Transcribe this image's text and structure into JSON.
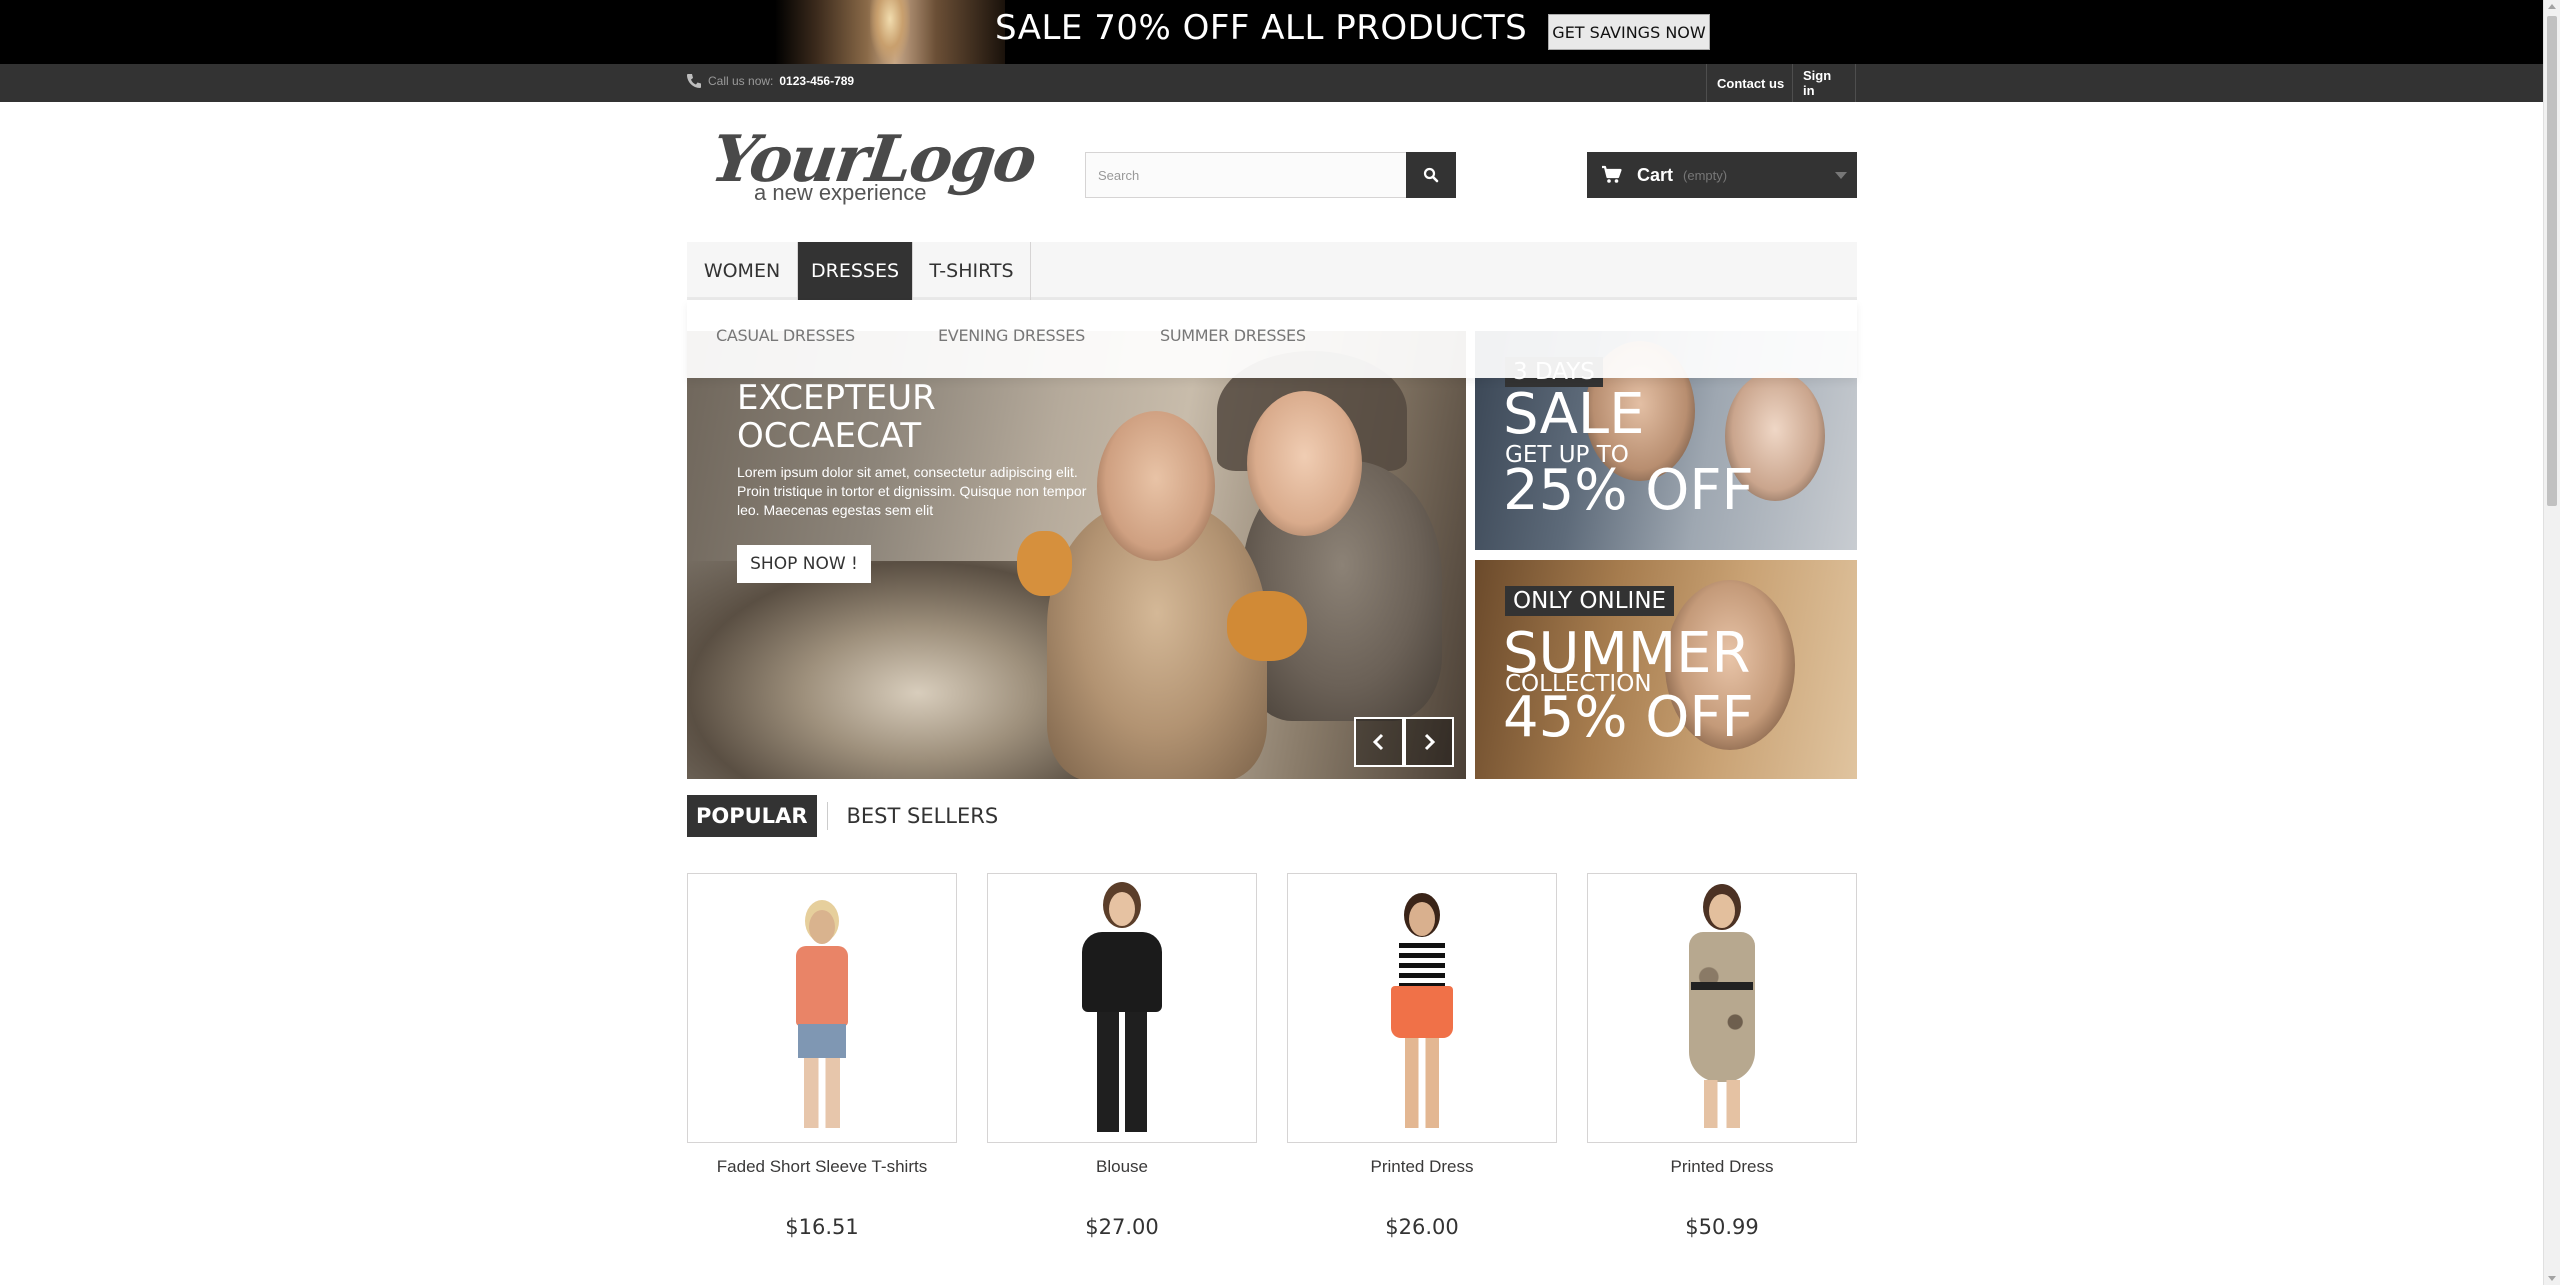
{
  "promo": {
    "text": "SALE 70% OFF ALL PRODUCTS",
    "button": "GET SAVINGS NOW"
  },
  "topbar": {
    "call_label": "Call us now:",
    "phone": "0123-456-789",
    "contact": "Contact us",
    "signin": "Sign in"
  },
  "header": {
    "logo_script": "YourLogo",
    "logo_tagline": "a new experience",
    "search_placeholder": "Search",
    "cart_label": "Cart",
    "cart_status": "(empty)"
  },
  "menu": {
    "items": [
      {
        "label": "WOMEN"
      },
      {
        "label": "DRESSES",
        "active": true
      },
      {
        "label": "T-SHIRTS"
      }
    ],
    "submenu": [
      "CASUAL DRESSES",
      "EVENING DRESSES",
      "SUMMER DRESSES"
    ]
  },
  "slider": {
    "title_line1": "EXCEPTEUR",
    "title_line2": "OCCAECAT",
    "text": "Lorem ipsum dolor sit amet, consectetur adipiscing elit. Proin tristique in tortor et dignissim. Quisque non tempor leo. Maecenas egestas sem elit",
    "button": "SHOP NOW !"
  },
  "banners": [
    {
      "badge": "3 DAYS",
      "line1": "SALE",
      "line2": "GET UP TO",
      "line3": "25% OFF"
    },
    {
      "badge": "ONLY ONLINE",
      "line1": "SUMMER",
      "line2": "COLLECTION",
      "line3": "45% OFF"
    }
  ],
  "tabs": {
    "popular": "POPULAR",
    "best_sellers": "BEST SELLERS"
  },
  "products": [
    {
      "name": "Faded Short Sleeve T-shirts",
      "price": "$16.51"
    },
    {
      "name": "Blouse",
      "price": "$27.00"
    },
    {
      "name": "Printed Dress",
      "price": "$26.00"
    },
    {
      "name": "Printed Dress",
      "price": "$50.99"
    }
  ],
  "colors": {
    "dark": "#333333",
    "promo_bg": "#000000",
    "border": "#d6d4d4"
  }
}
